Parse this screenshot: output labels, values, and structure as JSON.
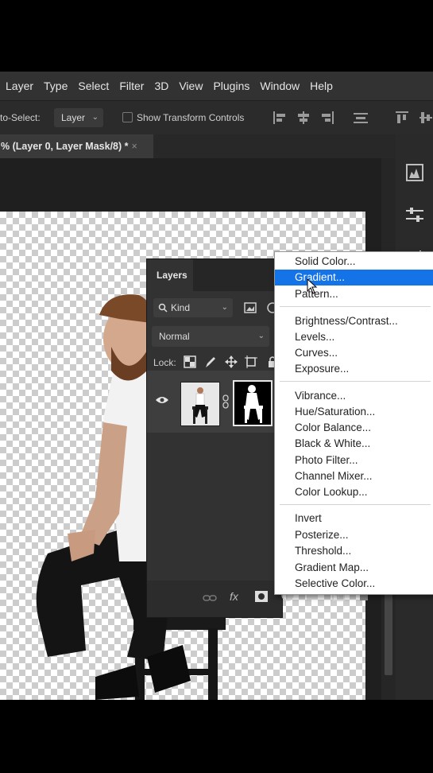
{
  "menubar": {
    "items": [
      "Layer",
      "Type",
      "Select",
      "Filter",
      "3D",
      "View",
      "Plugins",
      "Window",
      "Help"
    ]
  },
  "options": {
    "auto_select_label": "to-Select:",
    "auto_select_value": "Layer",
    "transform_label": "Show Transform Controls"
  },
  "tab": {
    "title": "% (Layer 0, Layer Mask/8) *",
    "close": "×"
  },
  "layers_panel": {
    "title": "Layers",
    "filter": "Kind",
    "blend_mode": "Normal",
    "lock_label": "Lock:"
  },
  "adjust_menu": {
    "group1": [
      "Solid Color...",
      "Gradient...",
      "Pattern..."
    ],
    "group2": [
      "Brightness/Contrast...",
      "Levels...",
      "Curves...",
      "Exposure..."
    ],
    "group3": [
      "Vibrance...",
      "Hue/Saturation...",
      "Color Balance...",
      "Black & White...",
      "Photo Filter...",
      "Channel Mixer...",
      "Color Lookup..."
    ],
    "group4": [
      "Invert",
      "Posterize...",
      "Threshold...",
      "Gradient Map...",
      "Selective Color..."
    ],
    "highlighted": "Gradient..."
  },
  "colors": {
    "accent": "#1473e6",
    "panel": "#323232",
    "menubar": "#323232"
  }
}
